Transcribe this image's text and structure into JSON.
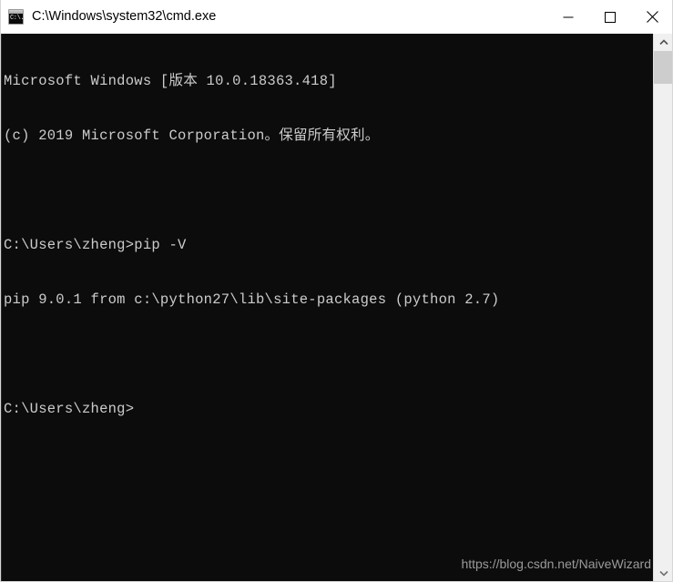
{
  "window": {
    "title": "C:\\Windows\\system32\\cmd.exe",
    "icon": "cmd-console-icon",
    "icon_glyph": "C:\\.",
    "titlebar_bg": "#ffffff",
    "terminal_bg": "#0c0c0c",
    "terminal_fg": "#cccccc"
  },
  "controls": {
    "minimize": "minimize-icon",
    "maximize": "maximize-icon",
    "close": "close-icon"
  },
  "terminal": {
    "lines": [
      "Microsoft Windows [版本 10.0.18363.418]",
      "(c) 2019 Microsoft Corporation。保留所有权利。",
      "",
      "C:\\Users\\zheng>pip -V",
      "pip 9.0.1 from c:\\python27\\lib\\site-packages (python 2.7)",
      "",
      "C:\\Users\\zheng>"
    ],
    "os_name": "Microsoft Windows",
    "os_version": "10.0.18363.418",
    "version_label": "版本",
    "copyright": "(c) 2019 Microsoft Corporation。保留所有权利。",
    "prompt": "C:\\Users\\zheng>",
    "command": "pip -V",
    "pip_version": "9.0.1",
    "pip_location": "c:\\python27\\lib\\site-packages",
    "python_version": "python 2.7"
  },
  "watermark": {
    "text": "https://blog.csdn.net/NaiveWizard"
  },
  "scrollbar": {
    "up_arrow": "chevron-up-icon",
    "down_arrow": "chevron-down-icon"
  }
}
